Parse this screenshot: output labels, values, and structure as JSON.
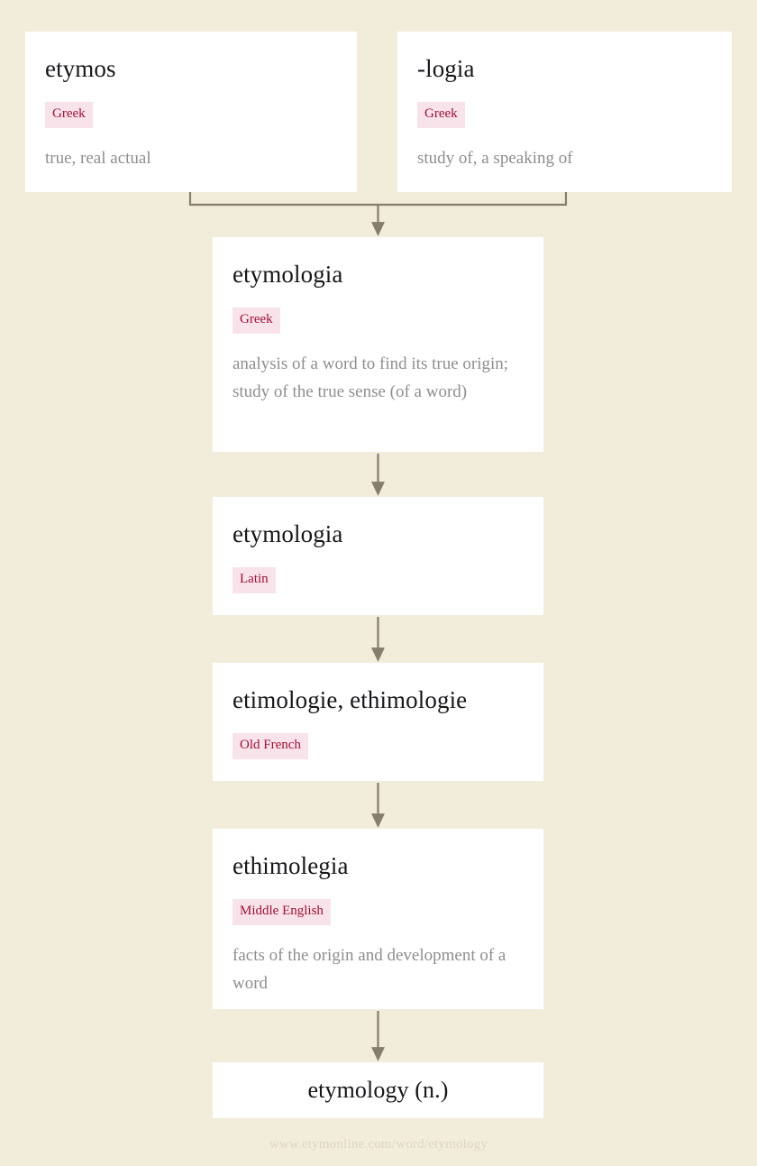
{
  "page": {
    "background_color": "#f2ecdb",
    "card_color": "#ffffff",
    "arrow_color": "#867d6c",
    "badge_bg_color": "#f8e3ea",
    "badge_text_color": "#9e1038",
    "definition_text_color": "#8e8e8e",
    "title_text_color": "#17161a",
    "footer_text_color": "#ddd6c2"
  },
  "roots": [
    {
      "title": "etymos",
      "language": "Greek",
      "definition": "true, real actual"
    },
    {
      "title": "-logia",
      "language": "Greek",
      "definition": "study of, a speaking of"
    }
  ],
  "chain": [
    {
      "title": "etymologia",
      "language": "Greek",
      "definition": "analysis of a word to find its true origin; study of the true sense (of a word)"
    },
    {
      "title": "etymologia",
      "language": "Latin",
      "definition": ""
    },
    {
      "title": "etimologie, ethimologie",
      "language": "Old French",
      "definition": ""
    },
    {
      "title": "ethimolegia",
      "language": "Middle English",
      "definition": "facts of the origin and development of a word"
    }
  ],
  "result": {
    "title": "etymology (n.)"
  },
  "footer": {
    "url": "www.etymonline.com/word/etymology"
  }
}
